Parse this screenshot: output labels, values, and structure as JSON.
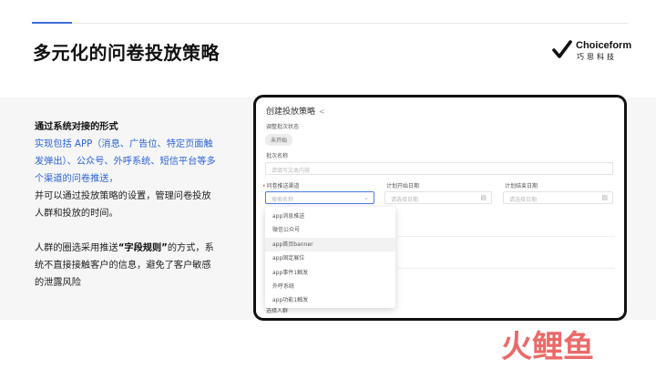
{
  "slide": {
    "title": "多元化的问卷投放策略",
    "accent_color": "#3f6fd8"
  },
  "logo": {
    "mark_icon": "choiceform-check-icon",
    "name_en": "Choiceform",
    "name_cn": "巧思科技"
  },
  "text": {
    "heading": "通过系统对接的形式",
    "blue_text": "实现包括 APP（消息、广告位、特定页面触发弹出）、公众号、外呼系统、短信平台等多个渠道的问卷推送，",
    "line_a": "并可以通过投放策略的设置，管理问卷投放人群和投放的时间。",
    "para2_prefix": "人群的圈选采用推送",
    "para2_bold": "“字段规则”",
    "para2_suffix": "的方式，系统不直接接触客户的信息，避免了客户敏感的泄露风险",
    "blue_color": "#2d63d8"
  },
  "form": {
    "title": "创建投放策略",
    "share_icon": "share-icon",
    "status_label": "调整批次状态",
    "status_value": "未开始",
    "batch_label": "批次名称",
    "batch_placeholder": "请填写文本内容",
    "channel_label": "问卷推送渠道",
    "channel_placeholder": "搜索名称",
    "start_label": "计划开始日期",
    "start_placeholder": "请选择日期",
    "end_label": "计划结束日期",
    "end_placeholder": "请选择日期",
    "bottom_label": "选择人群",
    "dropdown_items": [
      "app消息推送",
      "微信公众号",
      "app首页banner",
      "app固定展位",
      "app事件1触发",
      "外呼系统",
      "app功能1触发"
    ]
  },
  "watermark": {
    "text": "火鲤鱼",
    "color": "#e8504f"
  }
}
